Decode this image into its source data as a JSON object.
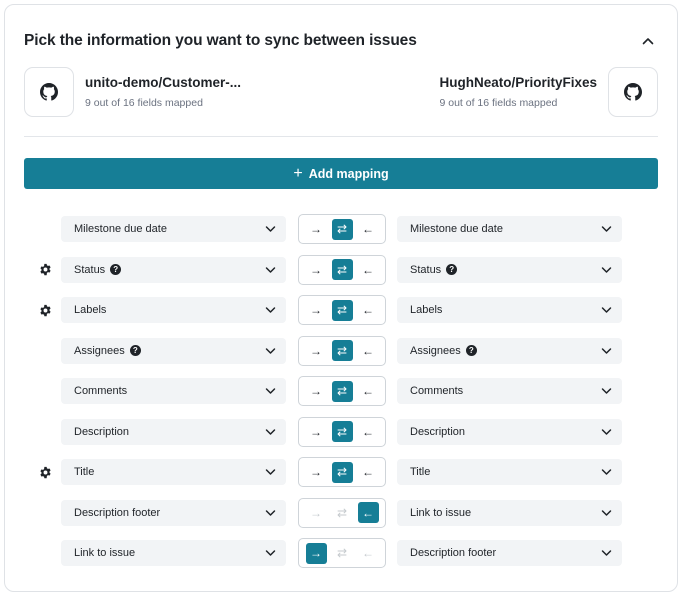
{
  "header": {
    "title": "Pick the information you want to sync between issues"
  },
  "left_repo": {
    "name": "unito-demo/Customer-...",
    "mapped": "9 out of 16 fields mapped"
  },
  "right_repo": {
    "name": "HughNeato/PriorityFixes",
    "mapped": "9 out of 16 fields mapped"
  },
  "add_mapping": {
    "label": "Add mapping"
  },
  "colors": {
    "accent": "#167e96",
    "field_bg": "#f2f4f6",
    "border": "#dfe2e6"
  },
  "direction_glyphs": {
    "to_right": "→",
    "both": "⇄",
    "to_left": "←"
  },
  "mappings": [
    {
      "left": "Milestone due date",
      "left_help": false,
      "right": "Milestone due date",
      "right_help": false,
      "gear": false,
      "direction": "both"
    },
    {
      "left": "Status",
      "left_help": true,
      "right": "Status",
      "right_help": true,
      "gear": true,
      "direction": "both"
    },
    {
      "left": "Labels",
      "left_help": false,
      "right": "Labels",
      "right_help": false,
      "gear": true,
      "direction": "both"
    },
    {
      "left": "Assignees",
      "left_help": true,
      "right": "Assignees",
      "right_help": true,
      "gear": false,
      "direction": "both"
    },
    {
      "left": "Comments",
      "left_help": false,
      "right": "Comments",
      "right_help": false,
      "gear": false,
      "direction": "both"
    },
    {
      "left": "Description",
      "left_help": false,
      "right": "Description",
      "right_help": false,
      "gear": false,
      "direction": "both"
    },
    {
      "left": "Title",
      "left_help": false,
      "right": "Title",
      "right_help": false,
      "gear": true,
      "direction": "both"
    },
    {
      "left": "Description footer",
      "left_help": false,
      "right": "Link to issue",
      "right_help": false,
      "gear": false,
      "direction": "to_left"
    },
    {
      "left": "Link to issue",
      "left_help": false,
      "right": "Description footer",
      "right_help": false,
      "gear": false,
      "direction": "to_right"
    }
  ]
}
